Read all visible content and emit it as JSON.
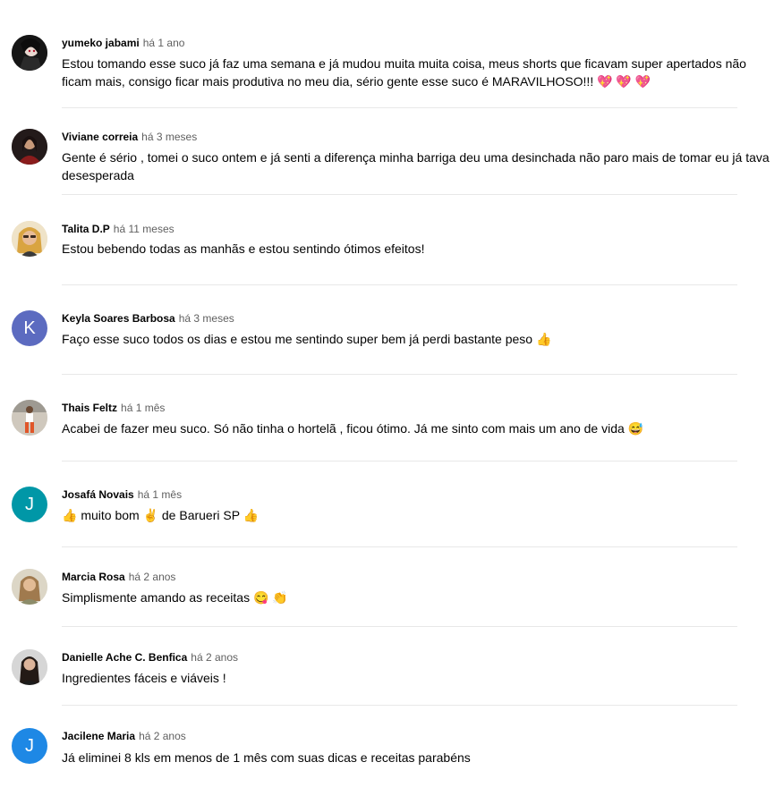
{
  "comments": [
    {
      "author": "yumeko jabami",
      "time": "há 1 ano",
      "text": "Estou tomando esse suco já faz uma semana e já mudou muita muita coisa, meus shorts que ficavam super apertados não ficam mais, consigo ficar mais produtiva no meu dia, sério gente esse suco é MARAVILHOSO!!! 💖 💖 💖",
      "avatar": {
        "type": "photo",
        "icon": "avatar-photo-icon"
      }
    },
    {
      "author": "Viviane correia",
      "time": "há 3 meses",
      "text": "Gente é sério , tomei o suco ontem e já senti a diferença minha barriga deu uma desinchada não paro mais de tomar eu já tava desesperada",
      "avatar": {
        "type": "photo",
        "icon": "avatar-photo-icon"
      }
    },
    {
      "author": "Talita D.P",
      "time": "há 11 meses",
      "text": "Estou bebendo todas as manhãs e estou sentindo ótimos efeitos!",
      "avatar": {
        "type": "photo",
        "icon": "avatar-photo-icon"
      }
    },
    {
      "author": "Keyla Soares Barbosa",
      "time": "há 3 meses",
      "text": "Faço esse suco todos os dias e estou me sentindo super bem já perdi bastante peso 👍",
      "avatar": {
        "type": "letter",
        "letter": "K",
        "color": "#5c6bc0"
      }
    },
    {
      "author": "Thais Feltz",
      "time": "há 1 mês",
      "text": "Acabei de fazer meu suco. Só não tinha o hortelã , ficou ótimo. Já me sinto com mais um ano de vida 😅",
      "avatar": {
        "type": "photo",
        "icon": "avatar-photo-icon"
      }
    },
    {
      "author": "Josafá Novais",
      "time": "há 1 mês",
      "text": "👍 muito bom ✌ de Barueri SP 👍",
      "avatar": {
        "type": "letter",
        "letter": "J",
        "color": "#0097a7"
      }
    },
    {
      "author": "Marcia Rosa",
      "time": "há 2 anos",
      "text": "Simplismente amando as receitas 😋 👏",
      "avatar": {
        "type": "photo",
        "icon": "avatar-photo-icon"
      }
    },
    {
      "author": "Danielle Ache C. Benfica",
      "time": "há 2 anos",
      "text": "Ingredientes fáceis e viáveis !",
      "avatar": {
        "type": "photo",
        "icon": "avatar-photo-icon"
      }
    },
    {
      "author": "Jacilene Maria",
      "time": "há 2 anos",
      "text": "Já eliminei 8 kls em menos de 1 mês  com suas dicas e receitas parabéns",
      "avatar": {
        "type": "letter",
        "letter": "J",
        "color": "#1e88e5"
      }
    }
  ]
}
